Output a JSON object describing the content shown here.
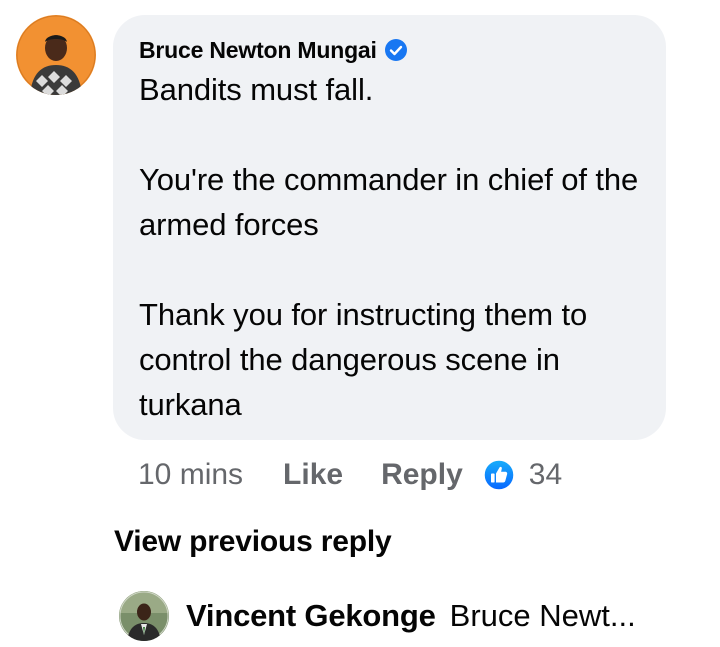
{
  "comment": {
    "author": "Bruce Newton Mungai",
    "verified": true,
    "text": "Bandits must fall.\n\nYou're the commander in chief of the armed forces\n\nThank you for instructing them to control the dangerous scene in turkana",
    "time": "10 mins",
    "like_label": "Like",
    "reply_label": "Reply",
    "reaction_icon": "thumbs-up-icon",
    "reaction_count": "34"
  },
  "replies": {
    "view_previous_label": "View previous reply",
    "preview": {
      "author": "Vincent Gekonge",
      "text": "Bruce Newt..."
    }
  },
  "colors": {
    "bubble": "#f0f2f5",
    "meta_text": "#65676b",
    "accent": "#1877f2",
    "avatar_main_bg": "#f08c2a"
  }
}
